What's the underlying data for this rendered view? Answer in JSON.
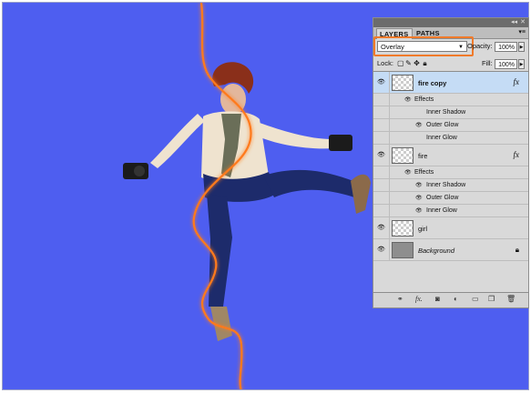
{
  "panel": {
    "tabs": [
      {
        "label": "LAYERS"
      },
      {
        "label": "PATHS"
      }
    ],
    "blend_mode": "Overlay",
    "opacity_label": "Opacity:",
    "opacity_value": "100%",
    "lock_label": "Lock:",
    "fill_label": "Fill:",
    "fill_value": "100%",
    "accent_color": "#f07a2a",
    "selected_row_color": "#c5dcf5"
  },
  "layers": [
    {
      "name": "fire copy",
      "selected": true,
      "fx": "fx",
      "effects_label": "Effects",
      "effects": [
        "Inner Shadow",
        "Outer Glow",
        "Inner Glow"
      ]
    },
    {
      "name": "fire",
      "selected": false,
      "fx": "fx",
      "effects_label": "Effects",
      "effects": [
        "Inner Shadow",
        "Outer Glow",
        "Inner Glow"
      ]
    },
    {
      "name": "girl",
      "selected": false
    },
    {
      "name": "Background",
      "selected": false,
      "locked": true
    }
  ],
  "footer_icons": [
    "link-icon",
    "fx-icon",
    "mask-icon",
    "adjustment-icon",
    "group-icon",
    "new-layer-icon",
    "trash-icon"
  ],
  "canvas": {
    "background_color": "#4e5ef0",
    "glow_color": "#ff7a1c"
  }
}
